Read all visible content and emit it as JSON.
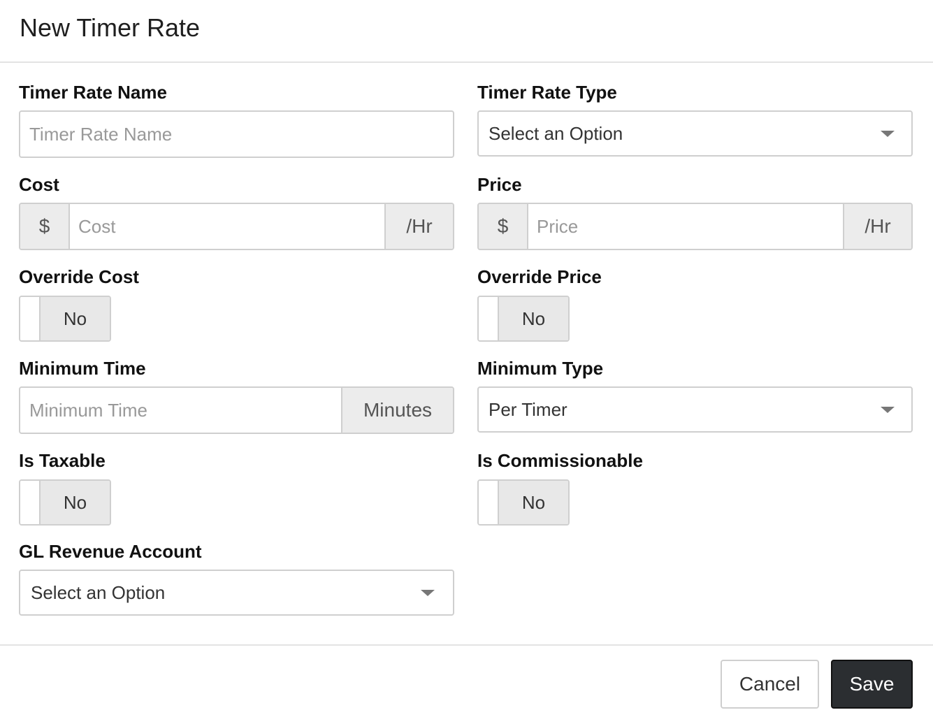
{
  "dialog": {
    "title": "New Timer Rate"
  },
  "form": {
    "timer_rate_name": {
      "label": "Timer Rate Name",
      "placeholder": "Timer Rate Name",
      "value": ""
    },
    "timer_rate_type": {
      "label": "Timer Rate Type",
      "selected": "Select an Option",
      "caret_icon": "chevron-down-icon"
    },
    "cost": {
      "label": "Cost",
      "prefix": "$",
      "placeholder": "Cost",
      "suffix": "/Hr",
      "value": ""
    },
    "price": {
      "label": "Price",
      "prefix": "$",
      "placeholder": "Price",
      "suffix": "/Hr",
      "value": ""
    },
    "override_cost": {
      "label": "Override Cost",
      "state": "No"
    },
    "override_price": {
      "label": "Override Price",
      "state": "No"
    },
    "minimum_time": {
      "label": "Minimum Time",
      "placeholder": "Minimum Time",
      "suffix": "Minutes",
      "value": ""
    },
    "minimum_type": {
      "label": "Minimum Type",
      "selected": "Per Timer",
      "caret_icon": "chevron-down-icon"
    },
    "is_taxable": {
      "label": "Is Taxable",
      "state": "No"
    },
    "is_commissionable": {
      "label": "Is Commissionable",
      "state": "No"
    },
    "gl_revenue_account": {
      "label": "GL Revenue Account",
      "selected": "Select an Option",
      "caret_icon": "chevron-down-icon"
    }
  },
  "footer": {
    "cancel_label": "Cancel",
    "save_label": "Save"
  },
  "colors": {
    "save_bg": "#2b2e31",
    "addon_bg": "#ececec",
    "toggle_bg": "#e8e8e8",
    "border": "#cfcfcf"
  }
}
